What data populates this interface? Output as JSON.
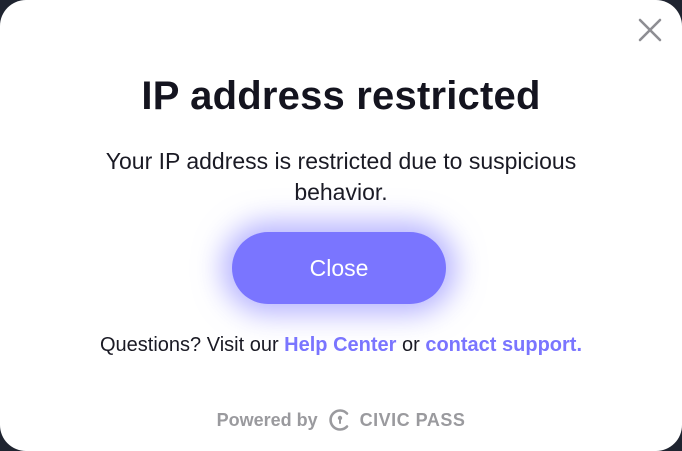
{
  "dialog": {
    "title": "IP address restricted",
    "message": "Your IP address is restricted due to suspicious behavior.",
    "primary_button_label": "Close",
    "close_icon": "close-icon"
  },
  "footer": {
    "question_prefix": "Questions? Visit our",
    "help_center_label": "Help Center",
    "or_text": "or",
    "contact_support_label": "contact support.",
    "powered_by_label": "Powered by",
    "brand_name": "CIVIC PASS",
    "brand_icon": "civic-pass-logo-icon"
  },
  "colors": {
    "accent": "#7a75ff",
    "title": "#14141f",
    "muted": "#9a9a9e"
  }
}
